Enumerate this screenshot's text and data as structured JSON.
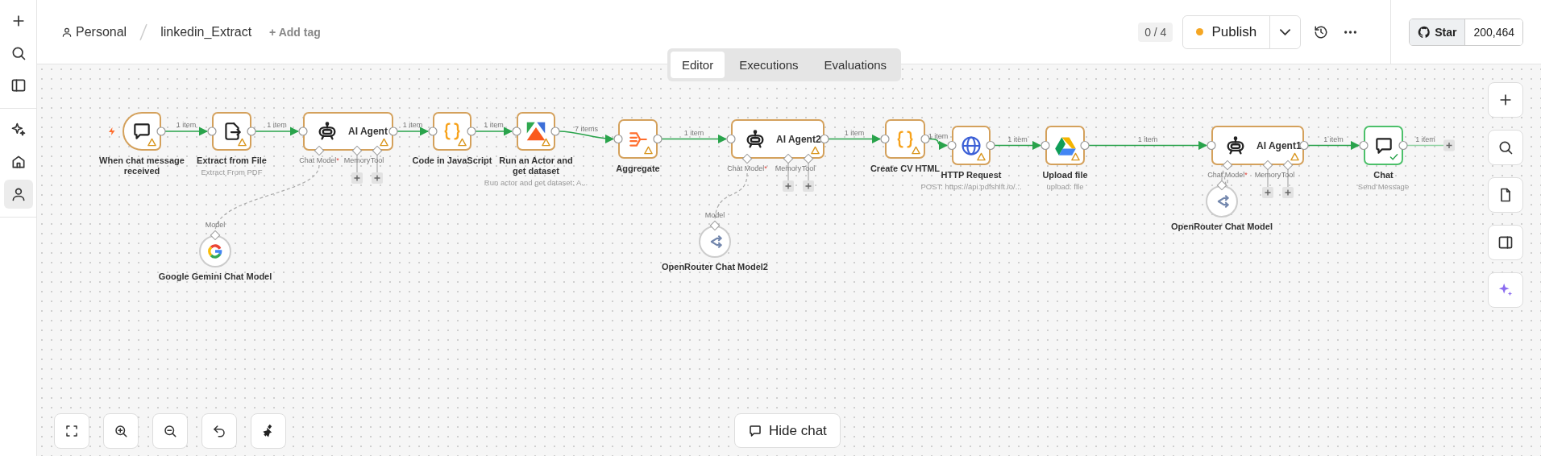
{
  "sidebar": {
    "items": [
      {
        "kind": "add",
        "selected": false
      },
      {
        "kind": "search",
        "selected": false
      },
      {
        "kind": "panel",
        "selected": false
      },
      {
        "kind": "insights",
        "selected": false
      },
      {
        "kind": "home",
        "selected": false
      },
      {
        "kind": "user",
        "selected": true
      }
    ]
  },
  "header": {
    "project": "Personal",
    "workflow": "linkedin_Extract",
    "add_tag": "+ Add tag",
    "progress": "0 / 4",
    "publish": {
      "label": "Publish",
      "unpublished_changes": true
    },
    "github": {
      "label": "Star",
      "count": "200,464"
    }
  },
  "tabs": [
    {
      "label": "Editor",
      "selected": true
    },
    {
      "label": "Executions",
      "selected": false
    },
    {
      "label": "Evaluations",
      "selected": false
    }
  ],
  "canvas": {
    "nodes": [
      {
        "kind": "trigger",
        "title": "When chat message received",
        "has_issues": true,
        "succeeded": false
      },
      {
        "kind": "extract",
        "title": "Extract from File",
        "subtitle": "Extract From PDF",
        "has_issues": true,
        "succeeded": false
      },
      {
        "kind": "agent",
        "title": "AI Agent",
        "has_issues": true,
        "succeeded": false,
        "ports": [
          {
            "label": "Chat Model",
            "mark": "*",
            "model": {
              "kind": "gemini",
              "title": "Google Gemini Chat Model",
              "input_label": "Model"
            }
          },
          {
            "label": "Memory"
          },
          {
            "label": "Tool"
          }
        ]
      },
      {
        "kind": "code",
        "title": "Code in JavaScript",
        "has_issues": true,
        "succeeded": false
      },
      {
        "kind": "actor",
        "title": "Run an Actor and get dataset",
        "subtitle": "Run actor and get dataset: A...",
        "has_issues": true,
        "succeeded": false
      },
      {
        "kind": "aggregate",
        "title": "Aggregate",
        "has_issues": true,
        "succeeded": false
      },
      {
        "kind": "agent",
        "title": "AI Agent2",
        "has_issues": true,
        "succeeded": false,
        "ports": [
          {
            "label": "Chat Model",
            "mark": "*",
            "model": {
              "kind": "openrouter",
              "title": "OpenRouter Chat Model2",
              "input_label": "Model"
            }
          },
          {
            "label": "Memory"
          },
          {
            "label": "Tool"
          }
        ]
      },
      {
        "kind": "code",
        "title": "Create CV HTML",
        "has_issues": true,
        "succeeded": false
      },
      {
        "kind": "http",
        "title": "HTTP Request",
        "subtitle": "POST: https://api.pdfshift.io/...",
        "has_issues": true,
        "succeeded": false
      },
      {
        "kind": "drive",
        "title": "Upload file",
        "subtitle": "upload: file",
        "has_issues": true,
        "succeeded": false
      },
      {
        "kind": "agent",
        "title": "AI Agent1",
        "has_issues": true,
        "succeeded": false,
        "ports": [
          {
            "label": "Chat Model",
            "mark": "*",
            "model": {
              "kind": "openrouter",
              "title": "OpenRouter Chat Model"
            }
          },
          {
            "label": "Memory"
          },
          {
            "label": "Tool"
          }
        ]
      },
      {
        "kind": "chat",
        "title": "Chat",
        "subtitle": "Send Message",
        "has_issues": false,
        "succeeded": true
      }
    ],
    "edges": [
      {
        "label": "1 item"
      },
      {
        "label": "1 item"
      },
      {
        "label": "1 item"
      },
      {
        "label": "1 item"
      },
      {
        "label": "7 items"
      },
      {
        "label": "1 item"
      },
      {
        "label": "1 item"
      },
      {
        "label": "1 item"
      },
      {
        "label": "1 item"
      },
      {
        "label": "1 item"
      },
      {
        "label": "1 item"
      },
      {
        "label": "1 item"
      }
    ]
  },
  "chat_toggle": {
    "label": "Hide chat"
  }
}
